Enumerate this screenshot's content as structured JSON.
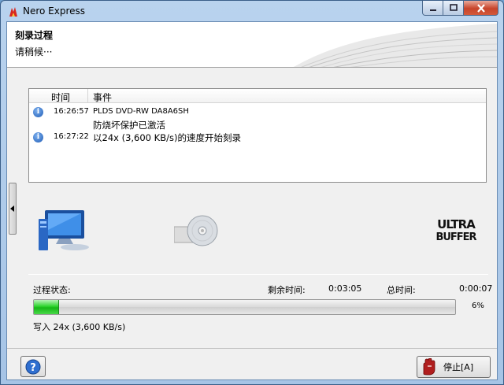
{
  "window": {
    "title": "Nero Express",
    "icon": "nero-flame-icon"
  },
  "header": {
    "title": "刻录过程",
    "subtitle": "请稍候···"
  },
  "log": {
    "columns": [
      "时间",
      "事件"
    ],
    "rows": [
      {
        "icon": "info-icon",
        "time": "16:26:57",
        "event": "PLDS DVD-RW DA8A6SH"
      },
      {
        "icon": "",
        "time": "",
        "event": "防烧坏保护已激活"
      },
      {
        "icon": "info-icon",
        "time": "16:27:22",
        "event": "以24x (3,600 KB/s)的速度开始刻录"
      }
    ]
  },
  "status": {
    "label": "过程状态:",
    "remaining_label": "剩余时间:",
    "remaining_value": "0:03:05",
    "total_label": "总时间:",
    "total_value": "0:00:07",
    "progress_percent": 6,
    "progress_text": "6%",
    "write_speed": "写入 24x (3,600 KB/s)"
  },
  "footer": {
    "stop_label": "停止[A]",
    "help_icon": "help-question-icon",
    "stop_icon": "stop-hand-icon"
  },
  "colors": {
    "progress_fill": "#22c722",
    "accent": "#1e5bb5"
  }
}
